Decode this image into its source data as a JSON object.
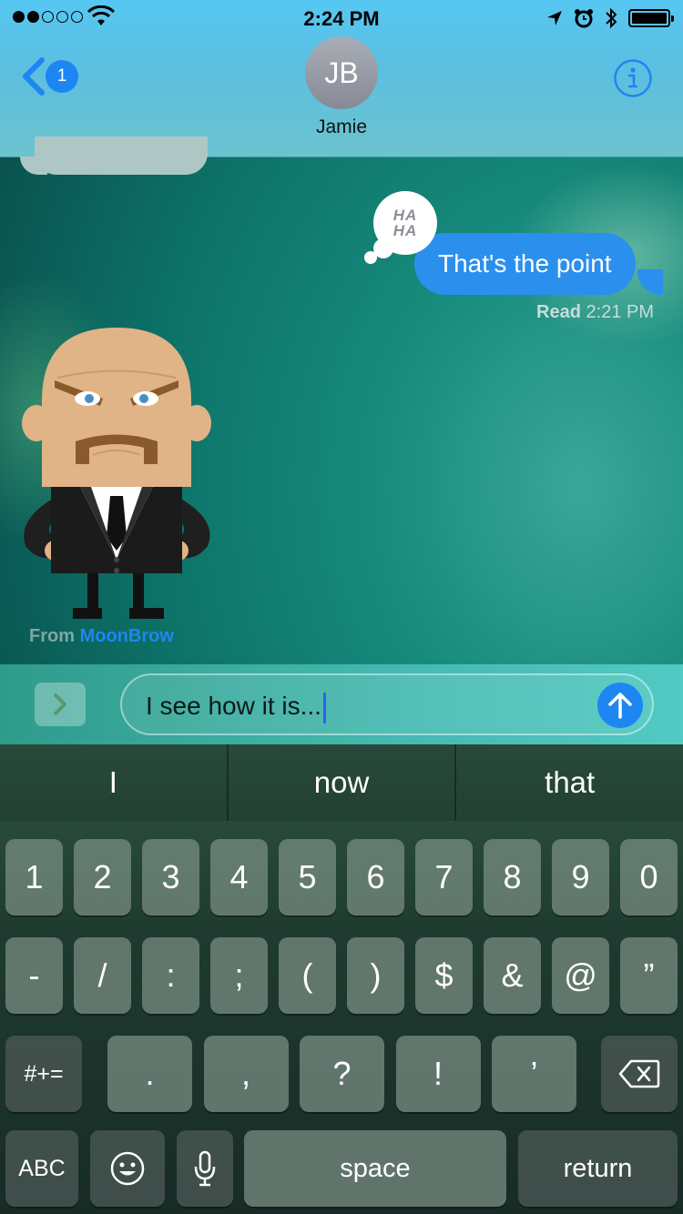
{
  "status_bar": {
    "time": "2:24 PM",
    "signal_bars_filled": 2,
    "signal_bars_total": 5,
    "icons": [
      "wifi-icon",
      "location-arrow-icon",
      "alarm-icon",
      "bluetooth-icon",
      "battery-icon"
    ],
    "battery_level": 1.0
  },
  "header": {
    "back_badge": "1",
    "avatar_initials": "JB",
    "contact_name": "Jamie",
    "accent_color": "#1e86f2"
  },
  "conversation": {
    "sent_message": "That's the point",
    "tapback": "HA HA",
    "read_label": "Read",
    "read_time": "2:21 PM",
    "sticker_from_label": "From",
    "sticker_app": "MoonBrow"
  },
  "input": {
    "text": "I see how it is..."
  },
  "keyboard": {
    "predictions": [
      "I",
      "now",
      "that"
    ],
    "row1": [
      "1",
      "2",
      "3",
      "4",
      "5",
      "6",
      "7",
      "8",
      "9",
      "0"
    ],
    "row2": [
      "-",
      "/",
      ":",
      ";",
      "(",
      ")",
      "$",
      "&",
      "@",
      "”"
    ],
    "row3_mode": "#+=",
    "row3": [
      ".",
      ",",
      "?",
      "!",
      "’"
    ],
    "abc": "ABC",
    "space": "space",
    "return": "return"
  }
}
